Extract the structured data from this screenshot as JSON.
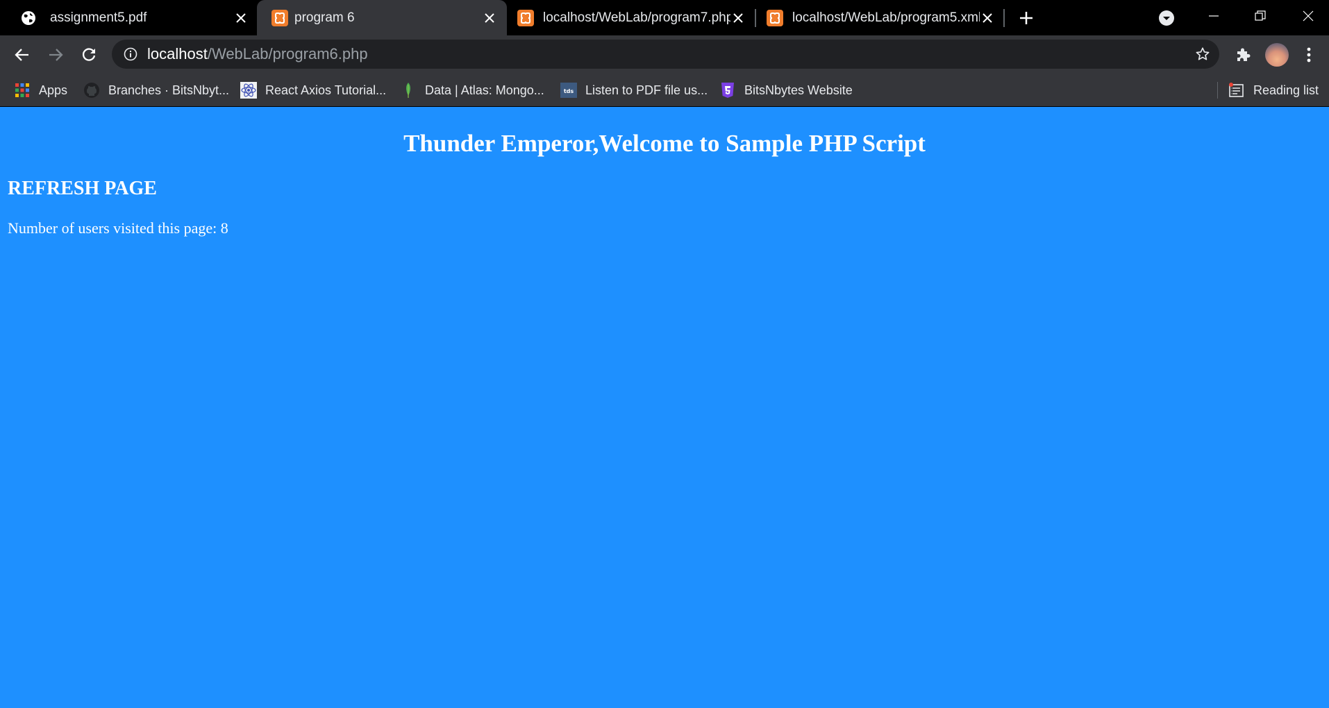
{
  "browser": {
    "tabs": [
      {
        "title": "assignment5.pdf",
        "favicon": "globe-icon",
        "active": false
      },
      {
        "title": "program 6",
        "favicon": "xampp-icon",
        "active": true
      },
      {
        "title": "localhost/WebLab/program7.php",
        "favicon": "xampp-icon",
        "active": false
      },
      {
        "title": "localhost/WebLab/program5.xml",
        "favicon": "xampp-icon",
        "active": false
      }
    ],
    "address": {
      "host": "localhost",
      "path": "/WebLab/program6.php"
    },
    "bookmarks": [
      {
        "label": "Apps",
        "icon": "apps-grid-icon"
      },
      {
        "label": "Branches · BitsNbyt...",
        "icon": "github-icon"
      },
      {
        "label": "React Axios Tutorial...",
        "icon": "react-icon"
      },
      {
        "label": "Data | Atlas: Mongo...",
        "icon": "mongodb-leaf-icon"
      },
      {
        "label": "Listen to PDF file us...",
        "icon": "tds-icon"
      },
      {
        "label": "BitsNbytes Website",
        "icon": "html5-icon"
      }
    ],
    "reading_list": "Reading list",
    "tds_badge": "tds"
  },
  "page": {
    "heading": "Thunder Emperor,Welcome to Sample PHP Script",
    "refresh": "REFRESH PAGE",
    "visitors": "Number of users visited this page: 8"
  },
  "colors": {
    "page_background": "#1e90ff",
    "tab_strip": "#000000",
    "toolbar": "#35363a",
    "omnibox": "#202124",
    "xampp_orange": "#f07d2c"
  }
}
